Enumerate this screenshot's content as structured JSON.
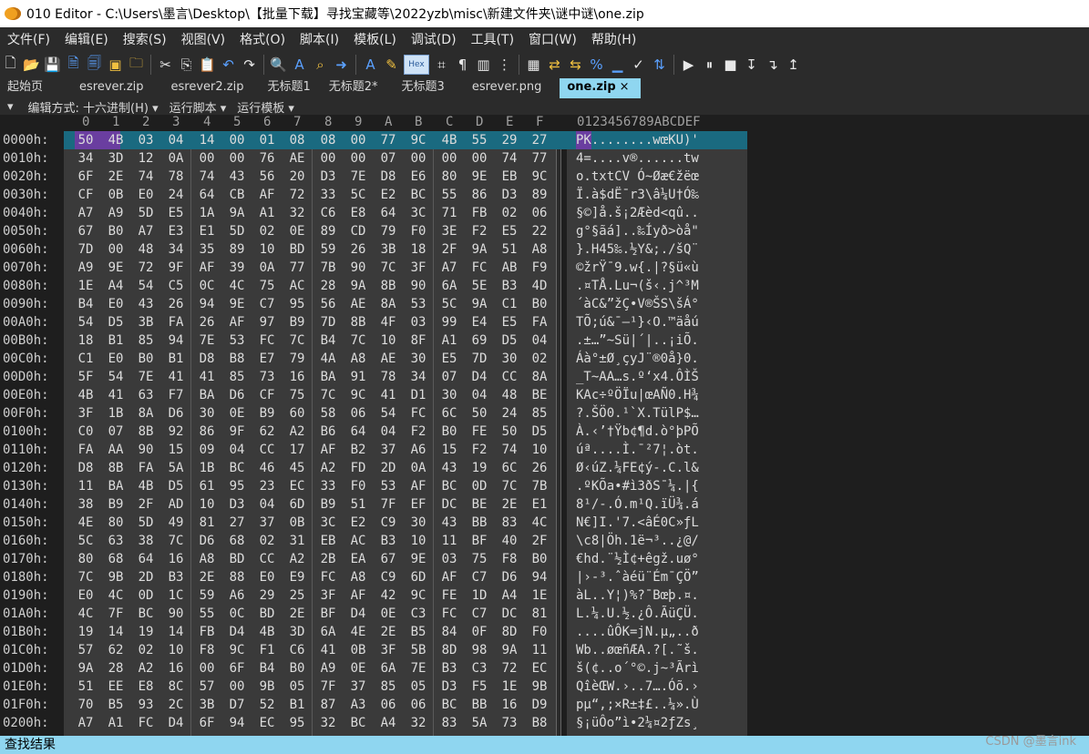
{
  "window": {
    "title": "010 Editor - C:\\Users\\墨言\\Desktop\\【批量下载】寻找宝藏等\\2022yzb\\misc\\新建文件夹\\谜中谜\\one.zip"
  },
  "menu": [
    "文件(F)",
    "编辑(E)",
    "搜索(S)",
    "视图(V)",
    "格式(O)",
    "脚本(I)",
    "模板(L)",
    "调试(D)",
    "工具(T)",
    "窗口(W)",
    "帮助(H)"
  ],
  "toolbar": {
    "hex_label": "Hex"
  },
  "tabs": [
    {
      "label": "起始页"
    },
    {
      "label": "esrever.zip"
    },
    {
      "label": "esrever2.zip"
    },
    {
      "label": "无标题1"
    },
    {
      "label": "无标题2*"
    },
    {
      "label": "无标题3"
    },
    {
      "label": "esrever.png"
    },
    {
      "label": "one.zip",
      "active": true,
      "close": "×"
    }
  ],
  "modebar": {
    "mode": "编辑方式: 十六进制(H) ▾",
    "script": "运行脚本 ▾",
    "template": "运行模板 ▾"
  },
  "hex_header": {
    "columns": [
      "0",
      "1",
      "2",
      "3",
      "4",
      "5",
      "6",
      "7",
      "8",
      "9",
      "A",
      "B",
      "C",
      "D",
      "E",
      "F"
    ],
    "ascii": "0123456789ABCDEF"
  },
  "rows": [
    {
      "addr": "0000h:",
      "hex": "50 4B 03 04 14 00 01 08 08 00 77 9C 4B 55 29 27",
      "ascii": "PK........wœKU)'"
    },
    {
      "addr": "0010h:",
      "hex": "34 3D 12 0A 00 00 76 AE 00 00 07 00 00 00 74 77",
      "ascii": "4=....v®......tw"
    },
    {
      "addr": "0020h:",
      "hex": "6F 2E 74 78 74 43 56 20 D3 7E D8 E6 80 9E EB 9C",
      "ascii": "o.txtCV Ó~Øæ€žëœ"
    },
    {
      "addr": "0030h:",
      "hex": "CF 0B E0 24 64 CB AF 72 33 5C E2 BC 55 86 D3 89",
      "ascii": "Ï.à$dË¯r3\\â¼U†Ó‰"
    },
    {
      "addr": "0040h:",
      "hex": "A7 A9 5D E5 1A 9A A1 32 C6 E8 64 3C 71 FB 02 06",
      "ascii": "§©]å.š¡2Æèd<qû.."
    },
    {
      "addr": "0050h:",
      "hex": "67 B0 A7 E3 E1 5D 02 0E 89 CD 79 F0 3E F2 E5 22",
      "ascii": "g°§ãá]..‰Íyð>òå\""
    },
    {
      "addr": "0060h:",
      "hex": "7D 00 48 34 35 89 10 BD 59 26 3B 18 2F 9A 51 A8",
      "ascii": "}.H45‰.½Y&;./šQ¨"
    },
    {
      "addr": "0070h:",
      "hex": "A9 9E 72 9F AF 39 0A 77 7B 90 7C 3F A7 FC AB F9",
      "ascii": "©žrŸ¯9.w{.|?§ü«ù"
    },
    {
      "addr": "0080h:",
      "hex": "1E A4 54 C5 0C 4C 75 AC 28 9A 8B 90 6A 5E B3 4D",
      "ascii": ".¤TÅ.Lu¬(š‹.j^³M"
    },
    {
      "addr": "0090h:",
      "hex": "B4 E0 43 26 94 9E C7 95 56 AE 8A 53 5C 9A C1 B0",
      "ascii": "´àC&”žÇ•V®ŠS\\šÁ°"
    },
    {
      "addr": "00A0h:",
      "hex": "54 D5 3B FA 26 AF 97 B9 7D 8B 4F 03 99 E4 E5 FA",
      "ascii": "TÕ;ú&¯—¹}‹O.™äåú"
    },
    {
      "addr": "00B0h:",
      "hex": "18 B1 85 94 7E 53 FC 7C B4 7C 10 8F A1 69 D5 04",
      "ascii": ".±…”~Sü|´|..¡iÕ."
    },
    {
      "addr": "00C0h:",
      "hex": "C1 E0 B0 B1 D8 B8 E7 79 4A A8 AE 30 E5 7D 30 02",
      "ascii": "Áà°±Ø¸çyJ¨®0å}0."
    },
    {
      "addr": "00D0h:",
      "hex": "5F 54 7E 41 41 85 73 16 BA 91 78 34 07 D4 CC 8A",
      "ascii": "_T~AA…s.º‘x4.ÔÌŠ"
    },
    {
      "addr": "00E0h:",
      "hex": "4B 41 63 F7 BA D6 CF 75 7C 9C 41 D1 30 04 48 BE",
      "ascii": "KAc÷ºÖÏu|œAÑ0.H¾"
    },
    {
      "addr": "00F0h:",
      "hex": "3F 1B 8A D6 30 0E B9 60 58 06 54 FC 6C 50 24 85",
      "ascii": "?.ŠÖ0.¹`X.TülP$…"
    },
    {
      "addr": "0100h:",
      "hex": "C0 07 8B 92 86 9F 62 A2 B6 64 04 F2 B0 FE 50 D5",
      "ascii": "À.‹’†Ÿb¢¶d.ò°þPÕ"
    },
    {
      "addr": "0110h:",
      "hex": "FA AA 90 15 09 04 CC 17 AF B2 37 A6 15 F2 74 10",
      "ascii": "úª....Ì.¯²7¦.òt."
    },
    {
      "addr": "0120h:",
      "hex": "D8 8B FA 5A 1B BC 46 45 A2 FD 2D 0A 43 19 6C 26",
      "ascii": "Ø‹úZ.¼FE¢ý-.C.l&"
    },
    {
      "addr": "0130h:",
      "hex": "11 BA 4B D5 61 95 23 EC 33 F0 53 AF BC 0D 7C 7B",
      "ascii": ".ºKÕa•#ì3ðS¯¼.|{"
    },
    {
      "addr": "0140h:",
      "hex": "38 B9 2F AD 10 D3 04 6D B9 51 7F EF DC BE 2E E1",
      "ascii": "8¹/-.Ó.m¹Q.ïÜ¾.á"
    },
    {
      "addr": "0150h:",
      "hex": "4E 80 5D 49 81 27 37 0B 3C E2 C9 30 43 BB 83 4C",
      "ascii": "N€]I.'7.<âÉ0C»ƒL"
    },
    {
      "addr": "0160h:",
      "hex": "5C 63 38 7C D6 68 02 31 EB AC B3 10 11 BF 40 2F",
      "ascii": "\\c8|Öh.1ë¬³..¿@/"
    },
    {
      "addr": "0170h:",
      "hex": "80 68 64 16 A8 BD CC A2 2B EA 67 9E 03 75 F8 B0",
      "ascii": "€hd.¨½Ì¢+êgž.uø°"
    },
    {
      "addr": "0180h:",
      "hex": "7C 9B 2D B3 2E 88 E0 E9 FC A8 C9 6D AF C7 D6 94",
      "ascii": "|›-³.ˆàéü¨Ém¯ÇÖ”"
    },
    {
      "addr": "0190h:",
      "hex": "E0 4C 0D 1C 59 A6 29 25 3F AF 42 9C FE 1D A4 1E",
      "ascii": "àL..Y¦)%?¯Bœþ.¤."
    },
    {
      "addr": "01A0h:",
      "hex": "4C 7F BC 90 55 0C BD 2E BF D4 0E C3 FC C7 DC 81",
      "ascii": "L.¼.U.½.¿Ô.ÃüÇÜ."
    },
    {
      "addr": "01B0h:",
      "hex": "19 14 19 14 FB D4 4B 3D 6A 4E 2E B5 84 0F 8D F0",
      "ascii": "....ûÔK=jN.µ„..ð"
    },
    {
      "addr": "01C0h:",
      "hex": "57 62 02 10 F8 9C F1 C6 41 0B 3F 5B 8D 98 9A 11",
      "ascii": "Wb..øœñÆA.?[.˜š."
    },
    {
      "addr": "01D0h:",
      "hex": "9A 28 A2 16 00 6F B4 B0 A9 0E 6A 7E B3 C3 72 EC",
      "ascii": "š(¢..o´°©.j~³Ãrì"
    },
    {
      "addr": "01E0h:",
      "hex": "51 EE E8 8C 57 00 9B 05 7F 37 85 05 D3 F5 1E 9B",
      "ascii": "QîèŒW.›..7….Óõ.›"
    },
    {
      "addr": "01F0h:",
      "hex": "70 B5 93 2C 3B D7 52 B1 87 A3 06 06 BC BB 16 D9",
      "ascii": "pµ“,;×R±‡£..¼».Ù"
    },
    {
      "addr": "0200h:",
      "hex": "A7 A1 FC D4 6F 94 EC 95 32 BC A4 32 83 5A 73 B8",
      "ascii": "§¡üÔo”ì•2¼¤2ƒZs¸"
    }
  ],
  "status": {
    "left": "查找结果"
  },
  "watermark": "CSDN @墨言ink"
}
